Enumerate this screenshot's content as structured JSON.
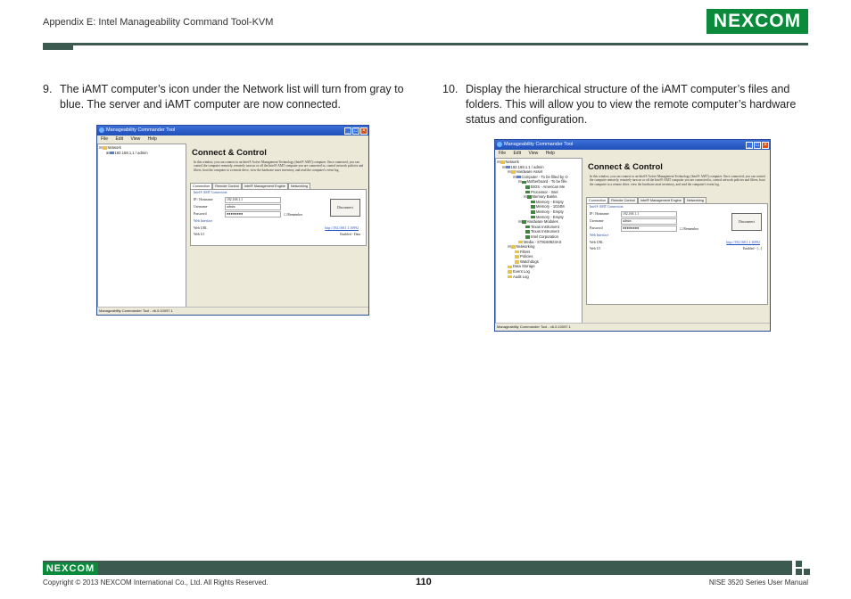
{
  "header": {
    "title": "Appendix E: Intel Manageability Command Tool-KVM",
    "brand": "NEXCOM"
  },
  "steps": [
    {
      "num": "9.",
      "text": "The iAMT computer’s icon under the Network list will turn from gray to blue. The server and iAMT computer are now connected."
    },
    {
      "num": "10.",
      "text": "Display the hierarchical structure of the iAMT computer’s files and folders. This will allow you to view the remote computer’s hardware status and configuration."
    }
  ],
  "app": {
    "window_title": "Manageability Commander Tool",
    "menu": [
      "File",
      "Edit",
      "View",
      "Help"
    ],
    "heading": "Connect & Control",
    "description": "In this window, you can connect to an Intel® Active Management Technology (Intel® AMT) computer. Once connected, you can control the computer remotely, remotely turn on or off the Intel® AMT computer you are connected to, control network policies and filters, boot the computer to a remote drive, view the hardware asset inventory, and read the computer's event log.",
    "tabs": [
      "Connection",
      "Remote Control",
      "Intel® Management Engine",
      "Networking"
    ],
    "group_connection": "Intel® AMT Connection",
    "label_ip": "IP / Hostname",
    "ip_value": "192.168.1.1",
    "label_username": "Username",
    "username_value": "admin",
    "label_password": "Password",
    "password_value": "●●●●●●●●",
    "remember_label": "Remember",
    "disconnect_label": "Disconnect",
    "group_web": "Web Interface",
    "label_weburl": "Web URL",
    "weburl_value": "http://192.168.1.1:16992",
    "label_webui": "Web UI",
    "webui_value_1": "Enabled - Data",
    "webui_value_2": "Enabled - [...]",
    "status": "Manageability Commander Tool - v6.0.10097.1",
    "tree1": [
      "Network",
      "192.168.1.1 / admin"
    ],
    "tree2": [
      "Network",
      "192.168.1.1 / admin",
      "Hardware Asset",
      "Computer - To be filled by O",
      "Motherboard - To be fille",
      "BIOS - American Me",
      "Processor - Intel",
      "Memory Banks",
      "Memory - Empty",
      "Memory - 1024M",
      "Memory - Empty",
      "Memory - Empty",
      "Hardware Modules",
      "Texas Instrument",
      "Texas Instrument",
      "Intel Corporation",
      "Media - ST9160823AS",
      "Networking",
      "Filters",
      "Policies",
      "Watchdogs",
      "Data Storage",
      "Event Log",
      "Audit Log"
    ]
  },
  "footer": {
    "brand": "NEXCOM",
    "copyright": "Copyright © 2013 NEXCOM International Co., Ltd. All Rights Reserved.",
    "page": "110",
    "manual": "NISE 3520 Series User Manual"
  }
}
